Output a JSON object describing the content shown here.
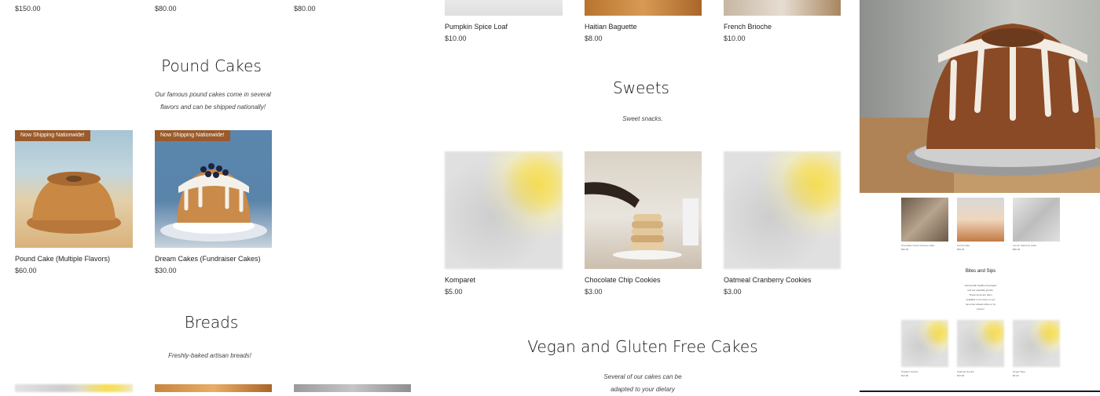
{
  "top_left": {
    "prices": [
      "$150.00",
      "$80.00",
      "$80.00"
    ]
  },
  "top_right": {
    "items": [
      {
        "name": "Pumpkin Spice Loaf",
        "price": "$10.00"
      },
      {
        "name": "Haitian Baguette",
        "price": "$8.00"
      },
      {
        "name": "French Brioche",
        "price": "$10.00"
      }
    ]
  },
  "pound_cakes": {
    "title": "Pound Cakes",
    "description_line1": "Our famous pound cakes come in several",
    "description_line2": "flavors and can be shipped nationally!",
    "items": [
      {
        "badge": "Now Shipping Nationwide!",
        "name": "Pound Cake (Multiple Flavors)",
        "price": "$60.00"
      },
      {
        "badge": "Now Shipping Nationwide!",
        "name": "Dream Cakes (Fundraiser Cakes)",
        "price": "$30.00"
      }
    ]
  },
  "sweets": {
    "title": "Sweets",
    "description": "Sweet snacks.",
    "items": [
      {
        "name": "Komparet",
        "price": "$5.00"
      },
      {
        "name": "Chocolate Chip Cookies",
        "price": "$3.00"
      },
      {
        "name": "Oatmeal Cranberry Cookies",
        "price": "$3.00"
      }
    ]
  },
  "breads": {
    "title": "Breads",
    "description": "Freshly-baked artisan breads!"
  },
  "vegan": {
    "title": "Vegan and Gluten Free Cakes",
    "description_line1": "Several of our cakes can be",
    "description_line2": "adapted to your dietary"
  },
  "preview": {
    "row1": [
      {
        "name": "Chocolate Cream Cheese Cake",
        "price": "$90.00"
      },
      {
        "name": "Carrot Cake",
        "price": "$65.00"
      },
      {
        "name": "Lemon Supreme Cake",
        "price": "$80.00"
      }
    ],
    "title": "Bites and Sips",
    "description": [
      "Homemade healthy beverages",
      "and our specialty gumbo.",
      "These items are often",
      "available in our store or you",
      "can order ahead online or by",
      "phone!"
    ],
    "row2": [
      {
        "name": "Chicken Gumbo",
        "price": "$12.00"
      },
      {
        "name": "Seafood Gumbo",
        "price": "$15.00"
      },
      {
        "name": "Ginger Beer",
        "price": "$6.00"
      }
    ]
  },
  "colors": {
    "badge": "#9a5a2a",
    "text": "#222222",
    "background": "#ffffff"
  }
}
